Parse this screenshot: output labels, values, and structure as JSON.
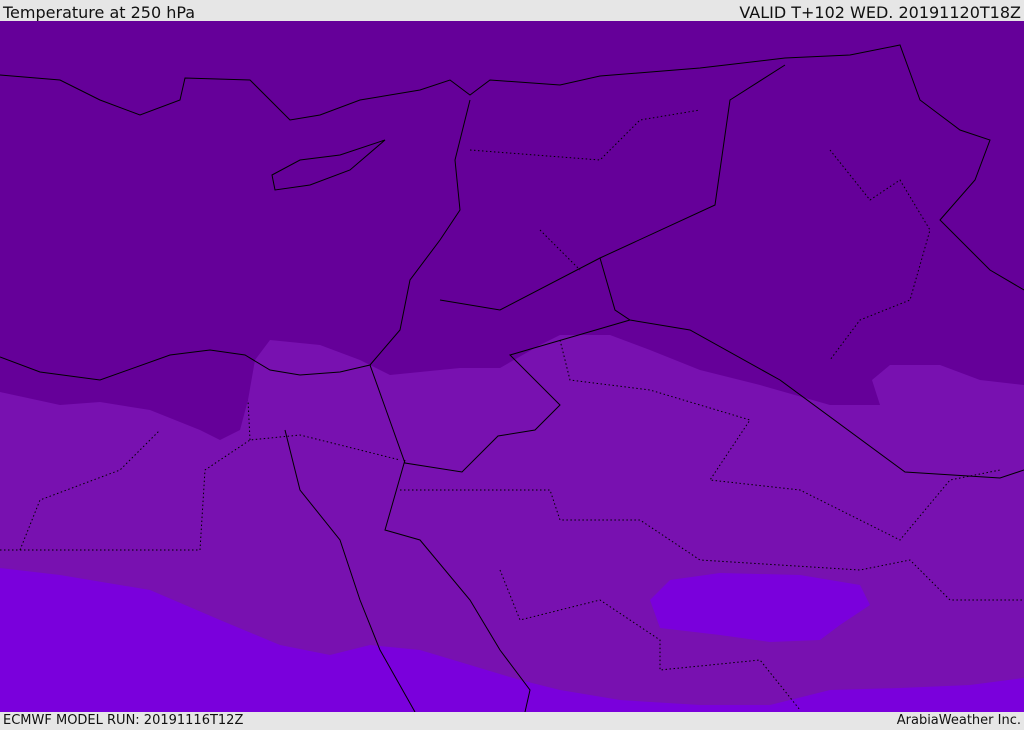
{
  "header": {
    "title": "Temperature at 250 hPa",
    "valid": "VALID T+102 WED. 20191120T18Z"
  },
  "footer": {
    "model_run": "ECMWF MODEL RUN: 20191116T12Z",
    "credit": "ArabiaWeather Inc."
  },
  "colors": {
    "cold": "#650099",
    "mid": "#7811b0",
    "warm": "#7a00dc",
    "header_bg": "#e6e6e6"
  }
}
